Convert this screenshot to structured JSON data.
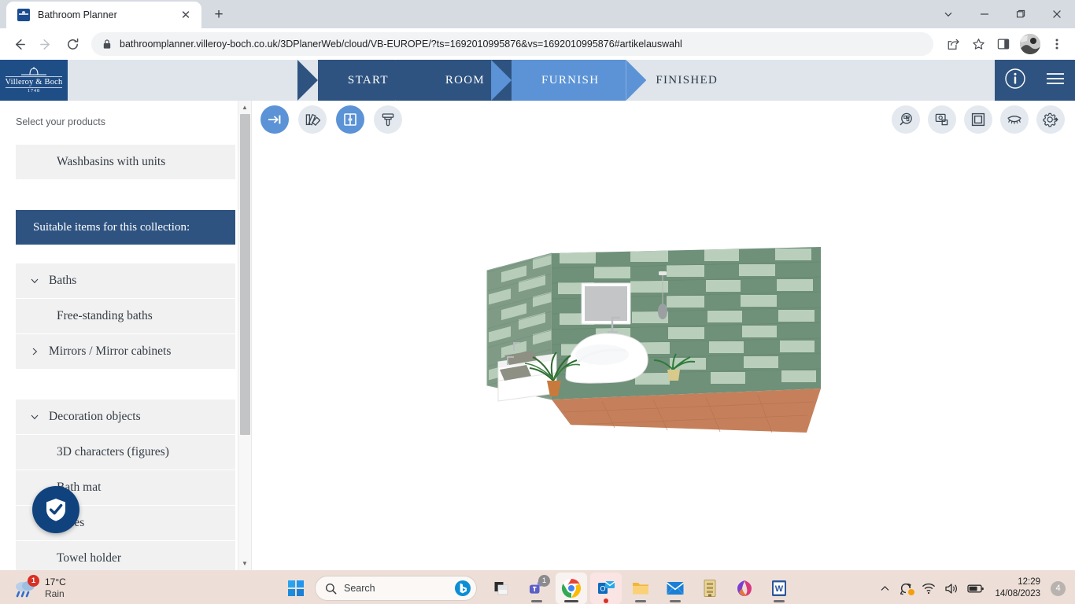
{
  "browser": {
    "tab": {
      "title": "Bathroom Planner",
      "favicon": "villeroy-boch-favicon",
      "close_label": "✕"
    },
    "new_tab_label": "+",
    "window_controls": {
      "tab_search": "tab-search",
      "minimize": "minimize",
      "maximize": "maximize",
      "close": "close"
    },
    "nav": {
      "back": "back",
      "forward": "forward",
      "reload": "reload"
    },
    "omnibox": {
      "url": "bathroomplanner.villeroy-boch.co.uk/3DPlanerWeb/cloud/VB-EUROPE/?ts=1692010995876&vs=1692010995876#artikelauswahl",
      "lock_icon": "lock-icon"
    },
    "toolbar_icons": [
      "share-icon",
      "bookmark-star-icon",
      "side-panel-icon",
      "profile-avatar",
      "chrome-menu-icon"
    ]
  },
  "app_header": {
    "logo": {
      "brand": "Villeroy & Boch",
      "year": "1748"
    },
    "steps": [
      {
        "label": "START",
        "state": "completed"
      },
      {
        "label": "ROOM",
        "state": "completed"
      },
      {
        "label": "FURNISH",
        "state": "active"
      },
      {
        "label": "FINISHED",
        "state": "upcoming"
      }
    ],
    "info_icon": "info-icon",
    "menu_icon": "hamburger-menu-icon",
    "colors": {
      "dark_blue": "#2e5380",
      "active_blue": "#5b93d6",
      "light_bar": "#dfe5eb",
      "logo_blue": "#1f4e87"
    }
  },
  "sidebar": {
    "label": "Select your products",
    "selected_category": "Washbasins with units",
    "collection_header": "Suitable items for this collection:",
    "groups": [
      {
        "title": "Baths",
        "expanded": true,
        "chevron": "chevron-down-icon",
        "items": [
          "Free-standing baths"
        ]
      },
      {
        "title": "Mirrors / Mirror cabinets",
        "expanded": false,
        "chevron": "chevron-right-icon",
        "items": []
      },
      {
        "title": "Decoration objects",
        "expanded": true,
        "chevron": "chevron-down-icon",
        "items": [
          "3D characters (figures)",
          "Bath mat",
          "Vases",
          "Towel holder"
        ]
      }
    ],
    "scrollbar": {
      "up_arrow": "▲",
      "down_arrow": "▼"
    },
    "trust_badge_icon": "shield-check-icon"
  },
  "canvas": {
    "toolbar_left": [
      {
        "name": "arrow-to-line-icon",
        "active": true
      },
      {
        "name": "material-samples-icon",
        "active": false
      },
      {
        "name": "cabinet-icon",
        "active": true
      },
      {
        "name": "paint-brush-icon",
        "active": false
      }
    ],
    "toolbar_right": [
      {
        "name": "floorplan-search-icon",
        "active": false
      },
      {
        "name": "screenshot-icon",
        "active": false
      },
      {
        "name": "frame-icon",
        "active": false
      },
      {
        "name": "eye-view-icon",
        "active": false
      },
      {
        "name": "settings-gear-icon",
        "active": false
      }
    ],
    "scene": {
      "description": "3D bathroom render",
      "wall_tile_dark": "#6f9079",
      "wall_tile_light": "#b9cfbb",
      "floor_color": "#c07a54",
      "fixtures": [
        "freestanding-bath",
        "double-washbasin-vanity",
        "wall-mirror",
        "pendant-lamp",
        "palm-plant",
        "potted-plant"
      ]
    }
  },
  "taskbar": {
    "weather": {
      "temperature": "17°C",
      "condition": "Rain",
      "badge": "1",
      "icon": "rain-cloud-icon"
    },
    "start_icon": "windows-start-icon",
    "search": {
      "placeholder": "Search",
      "icon": "search-icon",
      "bing_icon": "bing-chat-icon"
    },
    "apps": [
      {
        "name": "task-view-icon",
        "badge": null,
        "state": "idle"
      },
      {
        "name": "teams-icon",
        "badge": "1",
        "state": "running"
      },
      {
        "name": "chrome-icon",
        "badge": null,
        "state": "active"
      },
      {
        "name": "outlook-icon",
        "badge": null,
        "state": "active-alt"
      },
      {
        "name": "file-explorer-icon",
        "badge": null,
        "state": "running"
      },
      {
        "name": "mail-icon",
        "badge": null,
        "state": "running"
      },
      {
        "name": "archive-app-icon",
        "badge": null,
        "state": "idle"
      },
      {
        "name": "microsoft-365-icon",
        "badge": null,
        "state": "idle"
      },
      {
        "name": "word-icon",
        "badge": null,
        "state": "running"
      }
    ],
    "tray": {
      "overflow_icon": "chevron-up-icon",
      "onedrive_icon": "onedrive-sync-icon",
      "wifi_icon": "wifi-icon",
      "volume_icon": "volume-icon",
      "battery_icon": "battery-icon",
      "time": "12:29",
      "date": "14/08/2023",
      "notification_count": "4"
    }
  }
}
